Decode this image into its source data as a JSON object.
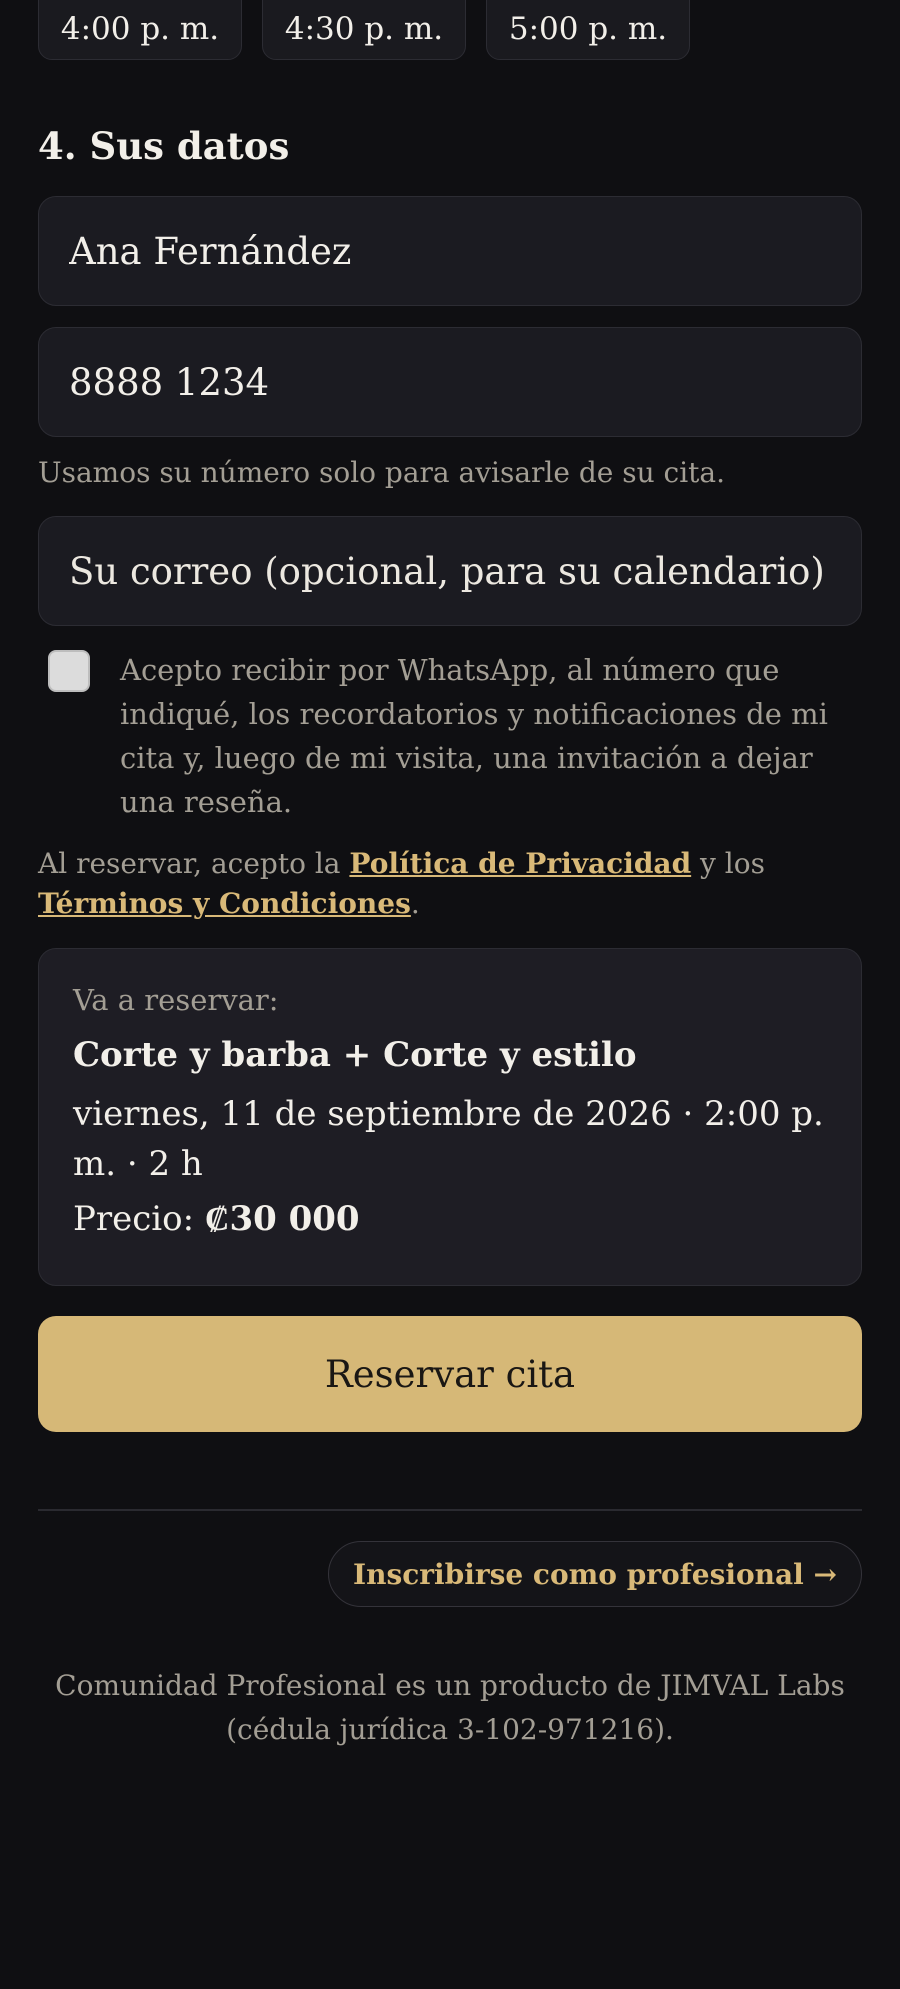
{
  "time_slots": [
    "4:00 p. m.",
    "4:30 p. m.",
    "5:00 p. m."
  ],
  "section": {
    "title": "4. Sus datos"
  },
  "form": {
    "name_value": "Ana Fernández",
    "phone_value": "8888 1234",
    "phone_helper": "Usamos su número solo para avisarle de su cita.",
    "email_placeholder": "Su correo (opcional, para su calendario)",
    "consent_text": "Acepto recibir por WhatsApp, al número que indiqué, los recordatorios y notificaciones de mi cita y, luego de mi visita, una invitación a dejar una reseña.",
    "consent_checked": false
  },
  "legal": {
    "prefix": "Al reservar, acepto la ",
    "privacy_link": "Política de Privacidad",
    "middle": " y los ",
    "terms_link": "Términos y Condiciones",
    "suffix": "."
  },
  "summary": {
    "label": "Va a reservar:",
    "service": "Corte y barba + Corte y estilo",
    "when": "viernes, 11 de septiembre de 2026 · 2:00 p. m. · 2 h",
    "price_label": "Precio: ",
    "price_value": "₡30 000"
  },
  "actions": {
    "reserve_label": "Reservar cita",
    "professional_label": "Inscribirse como profesional →"
  },
  "footer": {
    "text": "Comunidad Profesional es un producto de JIMVAL Labs (cédula jurídica 3-102-971216)."
  },
  "colors": {
    "background": "#0f0f12",
    "accent": "#d6b877",
    "muted": "#a39e94"
  }
}
